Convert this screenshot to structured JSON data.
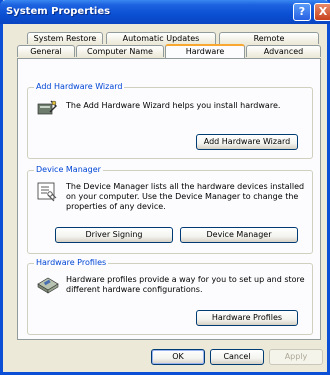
{
  "window": {
    "title": "System Properties"
  },
  "titlebar": {
    "help_glyph": "?",
    "close_glyph": "X"
  },
  "tabs": {
    "row1": [
      "System Restore",
      "Automatic Updates",
      "Remote"
    ],
    "row2": [
      "General",
      "Computer Name",
      "Hardware",
      "Advanced"
    ],
    "active": "Hardware"
  },
  "add_hardware": {
    "legend": "Add Hardware Wizard",
    "description": "The Add Hardware Wizard helps you install hardware.",
    "button": "Add Hardware Wizard",
    "icon": "add-hardware-icon"
  },
  "device_manager": {
    "legend": "Device Manager",
    "description_lines": [
      "The Device Manager lists all the hardware devices installed",
      "on your computer. Use the Device Manager to change the",
      "properties of any device."
    ],
    "driver_signing_button": "Driver Signing",
    "device_manager_button": "Device Manager",
    "icon": "device-manager-icon"
  },
  "hardware_profiles": {
    "legend": "Hardware Profiles",
    "description_lines": [
      "Hardware profiles provide a way for you to set up and store",
      "different hardware configurations."
    ],
    "button": "Hardware Profiles",
    "icon": "hardware-profiles-icon"
  },
  "footer": {
    "ok": "OK",
    "cancel": "Cancel",
    "apply": "Apply"
  },
  "colors": {
    "titlebar": "#0a4fd6",
    "legend": "#0046d5",
    "active_tab_accent": "#f8a830"
  }
}
